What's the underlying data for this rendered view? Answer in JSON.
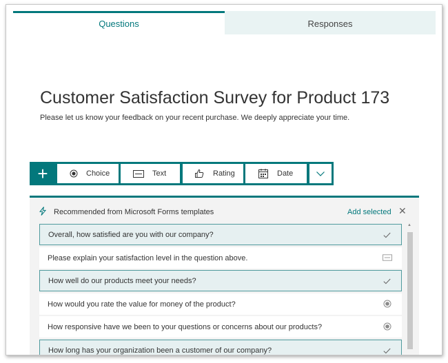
{
  "tabs": {
    "questions": "Questions",
    "responses": "Responses"
  },
  "form": {
    "title": "Customer Satisfaction Survey for Product 173",
    "description": "Please let us know your feedback on your recent purchase. We deeply appreciate your time."
  },
  "toolbar": {
    "add_icon": "+",
    "choice": "Choice",
    "text": "Text",
    "rating": "Rating",
    "date": "Date"
  },
  "recommended": {
    "label": "Recommended from Microsoft Forms templates",
    "add_selected": "Add selected",
    "close": "✕",
    "items": [
      {
        "text": "Overall, how satisfied are you with our company?",
        "selected": true,
        "icon": "check-icon"
      },
      {
        "text": "Please explain your satisfaction level in the question above.",
        "selected": false,
        "icon": "text-question-icon"
      },
      {
        "text": "How well do our products meet your needs?",
        "selected": true,
        "icon": "check-icon"
      },
      {
        "text": "How would you rate the value for money of the product?",
        "selected": false,
        "icon": "choice-question-icon"
      },
      {
        "text": "How responsive have we been to your questions or concerns about our products?",
        "selected": false,
        "icon": "choice-question-icon"
      },
      {
        "text": "How long has your organization been a customer of our company?",
        "selected": true,
        "icon": "check-icon"
      }
    ]
  },
  "colors": {
    "accent": "#03787c",
    "selected_bg": "#e6f0f1",
    "panel_bg": "#f3f3f3",
    "tab_inactive_bg": "#e9f3f3"
  }
}
